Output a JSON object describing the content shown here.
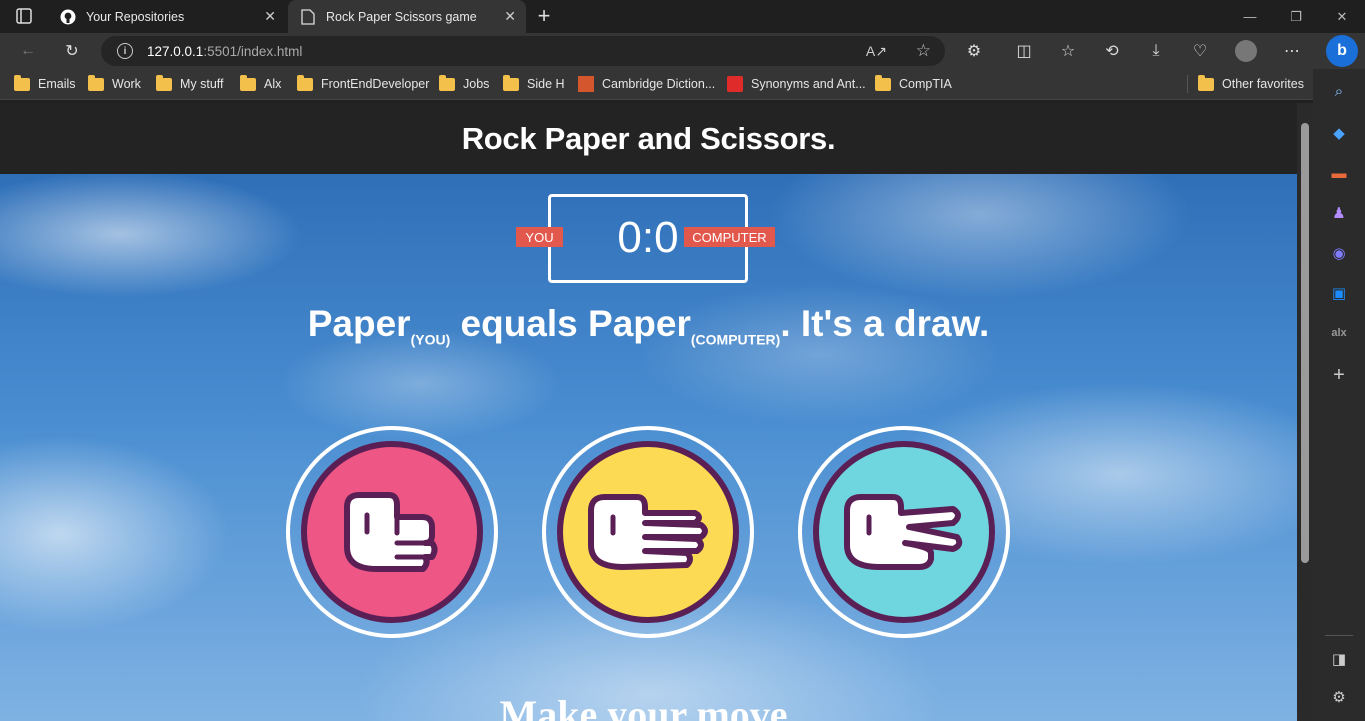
{
  "browser": {
    "tabs": [
      {
        "title": "Your Repositories"
      },
      {
        "title": "Rock Paper Scissors game"
      }
    ],
    "url_host": "127.0.0.1",
    "url_rest": ":5501/index.html",
    "bookmarks": [
      {
        "label": "Emails"
      },
      {
        "label": "Work"
      },
      {
        "label": "My stuff"
      },
      {
        "label": "Alx"
      },
      {
        "label": "FrontEndDeveloper"
      },
      {
        "label": "Jobs"
      },
      {
        "label": "Side H"
      },
      {
        "label": "Cambridge Diction..."
      },
      {
        "label": "Synonyms and Ant..."
      },
      {
        "label": "CompTIA"
      }
    ],
    "other_favorites": "Other favorites"
  },
  "game": {
    "title": "Rock Paper and Scissors.",
    "score": "0:0",
    "user_label": "YOU",
    "computer_label": "COMPUTER",
    "result": {
      "user_choice": "Paper",
      "user_tag": "(YOU)",
      "verb": "equals",
      "computer_choice": "Paper",
      "computer_tag": "(COMPUTER)",
      "outcome": ". It's a draw."
    },
    "choices": [
      {
        "name": "rock",
        "color": "#ee5686"
      },
      {
        "name": "paper",
        "color": "#fdda53"
      },
      {
        "name": "scissors",
        "color": "#6fd5df"
      }
    ],
    "prompt": "Make your move."
  }
}
